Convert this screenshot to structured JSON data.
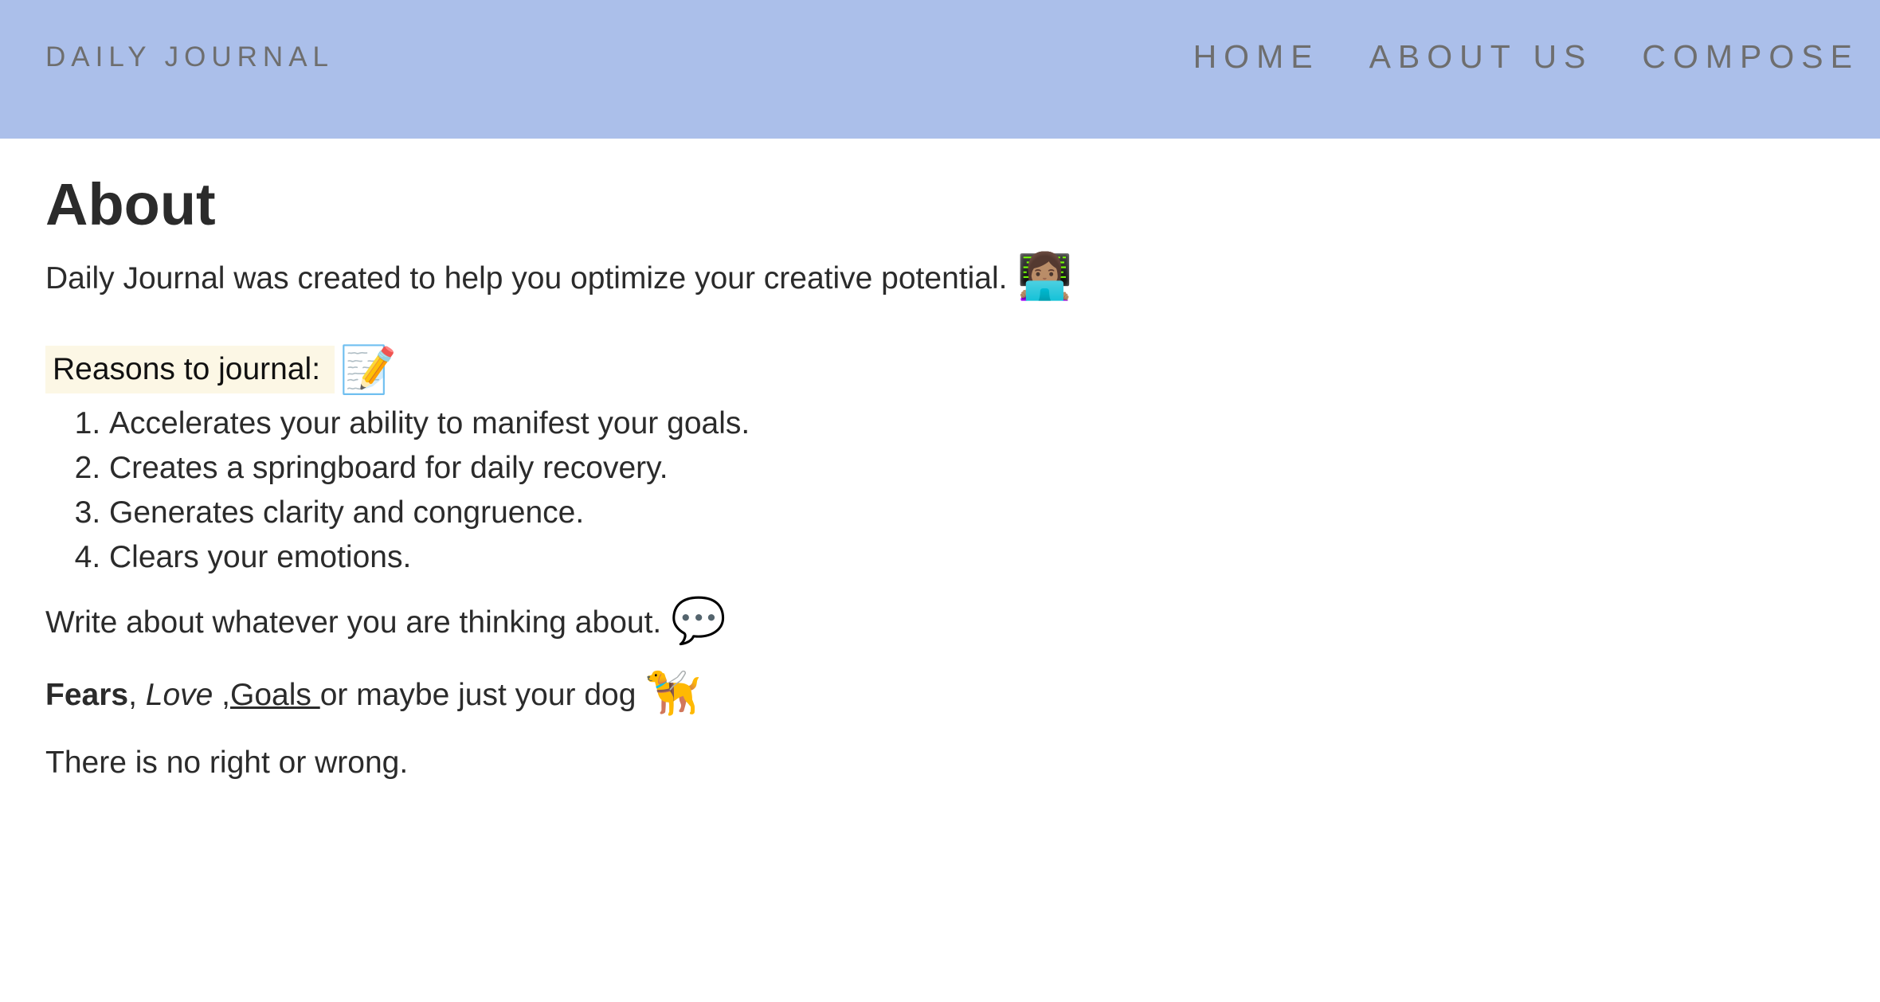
{
  "navbar": {
    "brand": "DAILY JOURNAL",
    "links": [
      "HOME",
      "ABOUT US",
      "COMPOSE"
    ],
    "background_color": "#abbfea"
  },
  "main": {
    "title": "About",
    "intro_text": "Daily Journal was created to help you optimize your creative potential.",
    "intro_emoji": "👩🏽‍💻",
    "reasons_label": "Reasons to journal:",
    "reasons_emoji": "📝",
    "reasons": [
      "Accelerates your ability to manifest your goals.",
      "Creates a springboard for daily recovery.",
      "Generates clarity and congruence.",
      "Clears your emotions."
    ],
    "write_text": "Write about whatever you are thinking about.",
    "write_emoji": "💬",
    "topics": {
      "fears": "Fears",
      "sep1": ", ",
      "love": "Love",
      "sep2": " ,",
      "goals": "Goals ",
      "rest": "or maybe just your dog",
      "emoji": "🦮"
    },
    "closing_text": "There is no right or wrong."
  }
}
